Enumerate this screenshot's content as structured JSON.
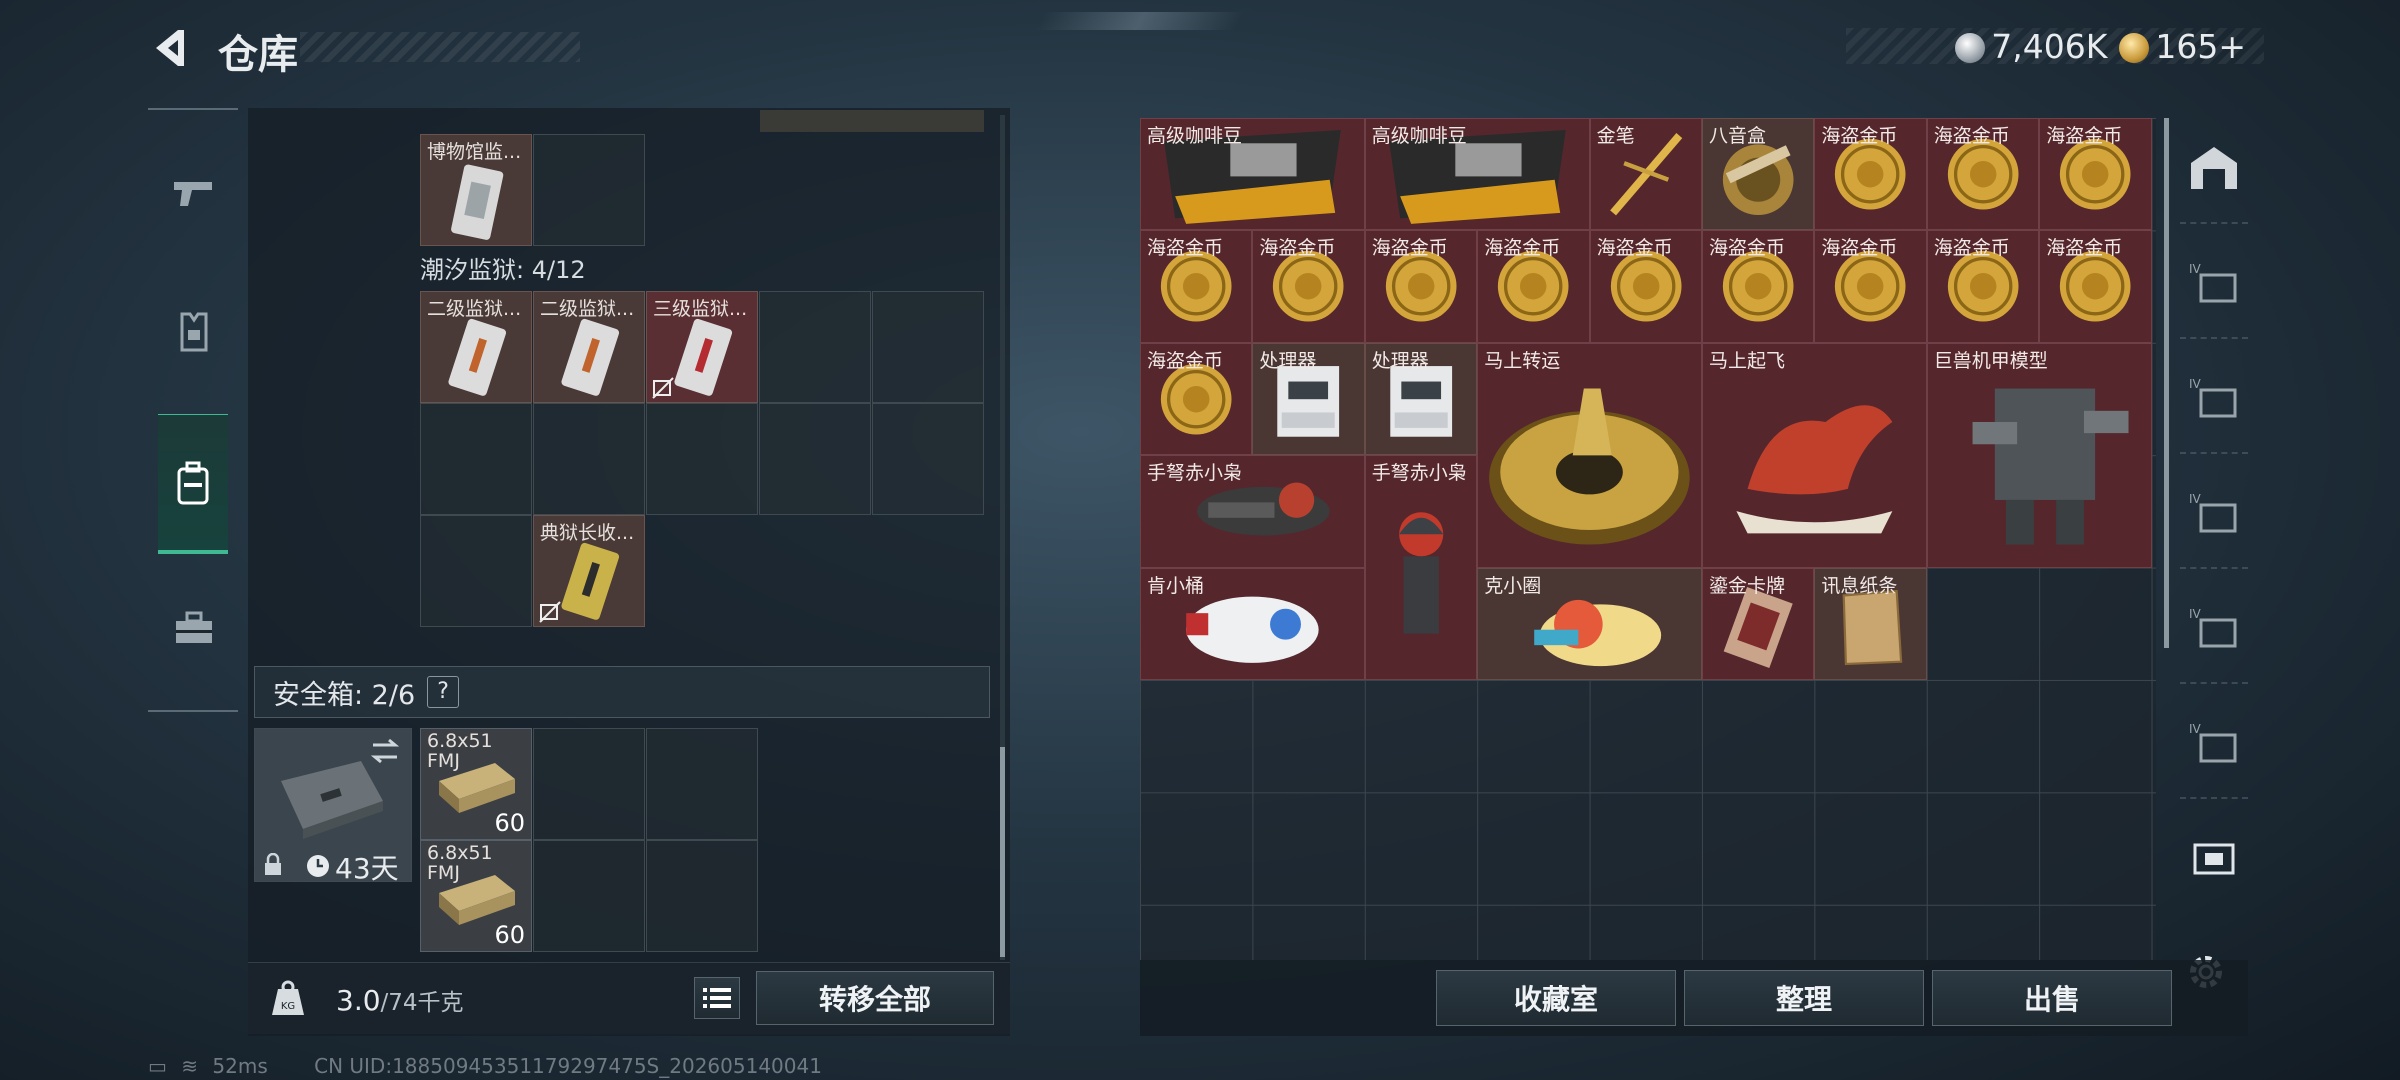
{
  "header": {
    "title": "仓库",
    "currency1": "7,406K",
    "currency2": "165+"
  },
  "left_panel": {
    "top_item_label": "博物馆监...",
    "prison_section": "潮汐监狱: 4/12",
    "prison_items": [
      "二级监狱...",
      "二级监狱...",
      "三级监狱...",
      "典狱长收..."
    ],
    "safe_box": {
      "title": "安全箱: 2/6",
      "help": "?",
      "timer": "43天",
      "ammo": [
        {
          "name": "6.8x51 FMJ",
          "count": "60"
        },
        {
          "name": "6.8x51 FMJ",
          "count": "60"
        }
      ]
    },
    "weight_value": "3.0",
    "weight_max": "/74千克",
    "transfer_all_label": "转移全部"
  },
  "right_panel": {
    "items": [
      "高级咖啡豆",
      "高级咖啡豆",
      "金笔",
      "八音盒",
      "海盗金币",
      "海盗金币",
      "海盗金币",
      "海盗金币",
      "海盗金币",
      "海盗金币",
      "海盗金币",
      "海盗金币",
      "海盗金币",
      "海盗金币",
      "海盗金币",
      "海盗金币",
      "海盗金币",
      "处理器",
      "处理器",
      "马上转运",
      "马上起飞",
      "巨兽机甲模型",
      "手弩赤小枭",
      "手弩赤小枭",
      "肯小桶",
      "克小圈",
      "鎏金卡牌",
      "讯息纸条"
    ],
    "buttons": {
      "collection": "收藏室",
      "organize": "整理",
      "sell": "出售"
    }
  },
  "status_bar": {
    "ping": "52ms",
    "uid": "CN UID:18850945351179297475S_202605140041"
  },
  "colors": {
    "accent_green": "#3fb893",
    "item_red": "#55272d",
    "item_brown": "#4a3633"
  }
}
